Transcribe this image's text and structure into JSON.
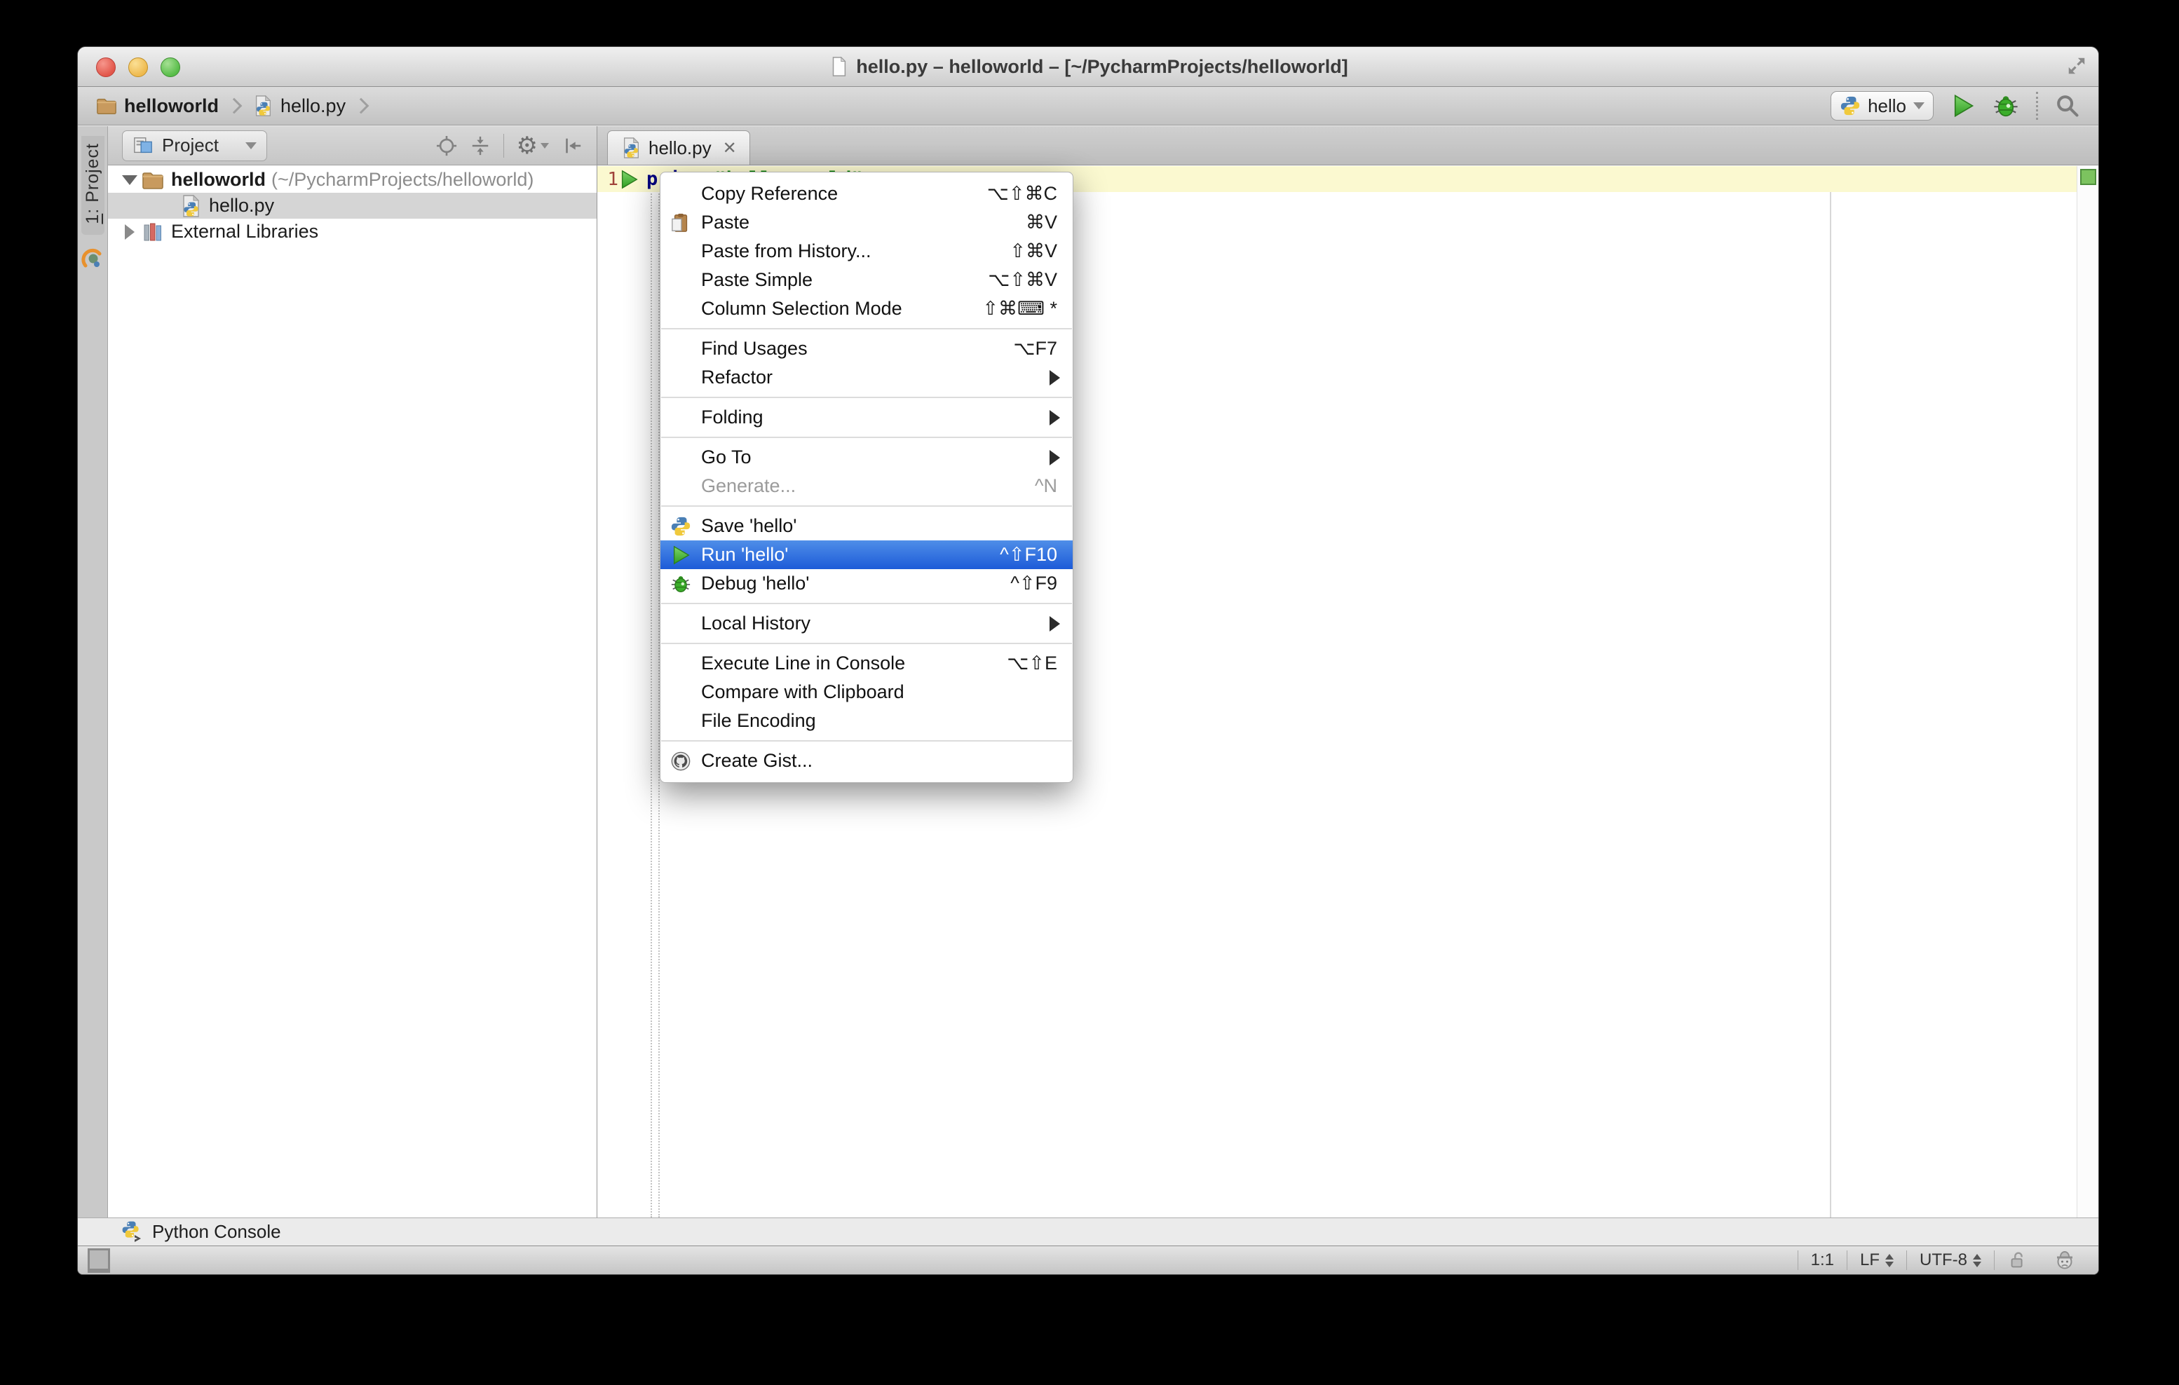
{
  "window": {
    "title": "hello.py – helloworld – [~/PycharmProjects/helloworld]"
  },
  "breadcrumb": {
    "items": [
      {
        "label": "helloworld",
        "icon": "folder",
        "bold": true
      },
      {
        "label": "hello.py",
        "icon": "python-file",
        "bold": false
      }
    ]
  },
  "toolbar": {
    "run_config": "hello",
    "icons": [
      "run",
      "debug",
      "search"
    ]
  },
  "tool_window_bar": {
    "mnemonic": "1",
    "label_rest": ": Project",
    "icon": "pycharm-logo"
  },
  "project_panel": {
    "view_selector": "Project",
    "header_icons": [
      "locate",
      "collapse-all",
      "settings",
      "hide-panel"
    ],
    "tree": [
      {
        "label": "helloworld",
        "detail": "(~/PycharmProjects/helloworld)",
        "icon": "folder",
        "arrow": "expanded",
        "bold": true,
        "selected": false,
        "indent": 0
      },
      {
        "label": "hello.py",
        "detail": "",
        "icon": "python-file",
        "arrow": "none",
        "bold": false,
        "selected": true,
        "indent": 1
      },
      {
        "label": "External Libraries",
        "detail": "",
        "icon": "library",
        "arrow": "collapsed",
        "bold": false,
        "selected": false,
        "indent": 0
      }
    ]
  },
  "editor": {
    "tab_label": "hello.py",
    "tab_close": "✕",
    "line_number": "1",
    "code_keyword": "print",
    "code_string": "\"hello world\""
  },
  "context_menu": {
    "sections": [
      [
        {
          "label": "Copy Reference",
          "shortcut": "⌥⇧⌘C"
        },
        {
          "label": "Paste",
          "shortcut": "⌘V",
          "icon": "paste"
        },
        {
          "label": "Paste from History...",
          "shortcut": "⇧⌘V"
        },
        {
          "label": "Paste Simple",
          "shortcut": "⌥⇧⌘V"
        },
        {
          "label": "Column Selection Mode",
          "shortcut": "⇧⌘⌨ *"
        }
      ],
      [
        {
          "label": "Find Usages",
          "shortcut": "⌥F7"
        },
        {
          "label": "Refactor",
          "submenu": true
        }
      ],
      [
        {
          "label": "Folding",
          "submenu": true
        }
      ],
      [
        {
          "label": "Go To",
          "submenu": true
        },
        {
          "label": "Generate...",
          "shortcut": "^N",
          "disabled": true
        }
      ],
      [
        {
          "label": "Save 'hello'",
          "icon": "python"
        },
        {
          "label": "Run 'hello'",
          "shortcut": "^⇧F10",
          "icon": "run",
          "highlighted": true
        },
        {
          "label": "Debug 'hello'",
          "shortcut": "^⇧F9",
          "icon": "debug"
        }
      ],
      [
        {
          "label": "Local History",
          "submenu": true
        }
      ],
      [
        {
          "label": "Execute Line in Console",
          "shortcut": "⌥⇧E"
        },
        {
          "label": "Compare with Clipboard"
        },
        {
          "label": "File Encoding"
        }
      ],
      [
        {
          "label": "Create Gist...",
          "icon": "github"
        }
      ]
    ]
  },
  "console_bar": {
    "label": "Python Console",
    "icon": "python-console"
  },
  "status_bar": {
    "caret_position": "1:1",
    "line_separator": "LF",
    "encoding": "UTF-8",
    "icons": [
      "unlock",
      "inspector"
    ]
  },
  "colors": {
    "menu_highlight": "#2a67d9",
    "run_green": "#3fae2c",
    "selection_gray": "#d5d5d5",
    "caret_line_yellow": "#fbf9d0",
    "keyword_blue": "#000080",
    "string_green": "#007d00"
  }
}
